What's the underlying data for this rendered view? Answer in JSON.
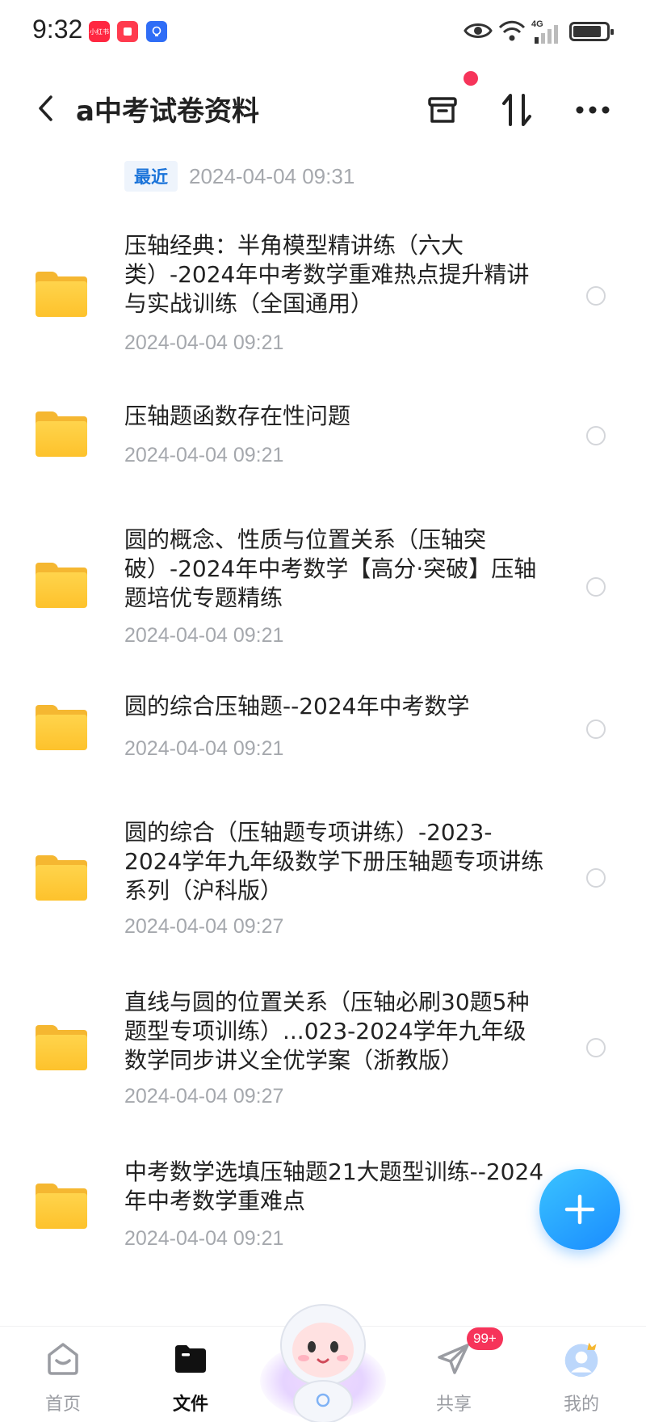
{
  "status_bar": {
    "time": "9:32",
    "app_badges": [
      "小红书",
      "",
      ""
    ],
    "network": "4G"
  },
  "header": {
    "title": "a中考试卷资料",
    "has_notification_dot": true
  },
  "recent": {
    "tag": "最近",
    "time": "2024-04-04  09:31"
  },
  "files": [
    {
      "name": "压轴经典：半角模型精讲练（六大类）-2024年中考数学重难热点提升精讲与实战训练（全国通用）",
      "date": "2024-04-04  09:21"
    },
    {
      "name": "压轴题函数存在性问题",
      "date": "2024-04-04  09:21"
    },
    {
      "name": "圆的概念、性质与位置关系（压轴突破）-2024年中考数学【高分·突破】压轴题培优专题精练",
      "date": "2024-04-04  09:21"
    },
    {
      "name": "圆的综合压轴题--2024年中考数学",
      "date": "2024-04-04  09:21"
    },
    {
      "name": "圆的综合（压轴题专项讲练）-2023-2024学年九年级数学下册压轴题专项讲练系列（沪科版）",
      "date": "2024-04-04  09:27"
    },
    {
      "name": "直线与圆的位置关系（压轴必刷30题5种题型专项训练）...023-2024学年九年级数学同步讲义全优学案（浙教版）",
      "date": "2024-04-04  09:27"
    },
    {
      "name": "中考数学选填压轴题21大题型训练--2024年中考数学重难点",
      "date": "2024-04-04  09:21"
    }
  ],
  "bottom_nav": {
    "home": "首页",
    "files": "文件",
    "share": "共享",
    "mine": "我的",
    "share_badge": "99+"
  },
  "colors": {
    "accent": "#1a8cff",
    "recent_tag": "#1a73d9",
    "badge_red": "#f6345a",
    "folder_yellow": "#fdc22c",
    "muted_text": "#a5a8ad"
  }
}
